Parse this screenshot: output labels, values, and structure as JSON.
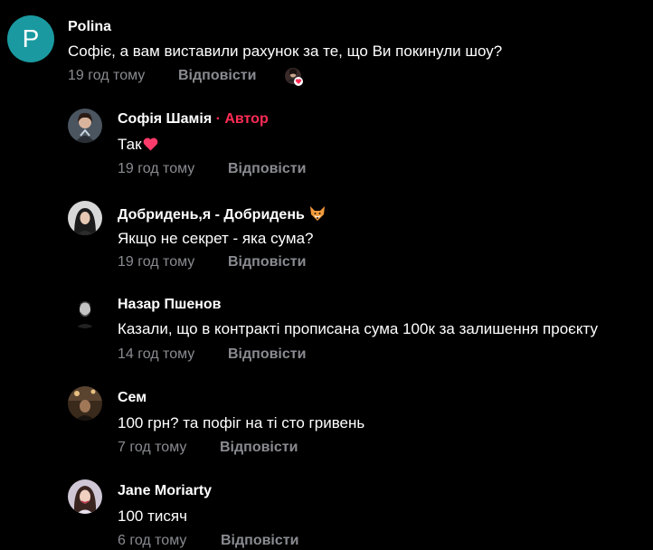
{
  "comments": [
    {
      "avatar_letter": "P",
      "author": "Polina",
      "text": "Софіє, а вам виставили рахунок за те, що Ви покинули шоу?",
      "time": "19 год тому",
      "reply_label": "Відповісти",
      "avatar_color": "#1a9aa0"
    }
  ],
  "replies": [
    {
      "author": "Софія Шамія",
      "author_tag": " · Автор",
      "text": "Так",
      "time": "19 год тому",
      "reply_label": "Відповісти"
    },
    {
      "author": "Добридень,я - Добридень",
      "text": "Якщо не секрет - яка сума?",
      "time": "19 год тому",
      "reply_label": "Відповісти"
    },
    {
      "author": "Назар Пшенов",
      "text": "Казали, що в контракті прописана сума 100к за залишення проєкту",
      "time": "14 год тому",
      "reply_label": "Відповісти"
    },
    {
      "author": "Сем",
      "text": "100 грн? та пофіг на ті сто гривень",
      "time": "7 год тому",
      "reply_label": "Відповісти"
    },
    {
      "author": "Jane Moriarty",
      "text": "100 тисяч",
      "time": "6 год тому",
      "reply_label": "Відповісти"
    }
  ],
  "colors": {
    "background": "#000000",
    "author_tag": "#fe2c55",
    "muted": "#8a8b91",
    "heart": "#ff3b6b"
  },
  "icons": {
    "liked_by_creator": "creator-avatar-with-heart-icon",
    "heart_emoji": "heart-emoji-icon",
    "fox_emoji": "fox-emoji-icon"
  }
}
